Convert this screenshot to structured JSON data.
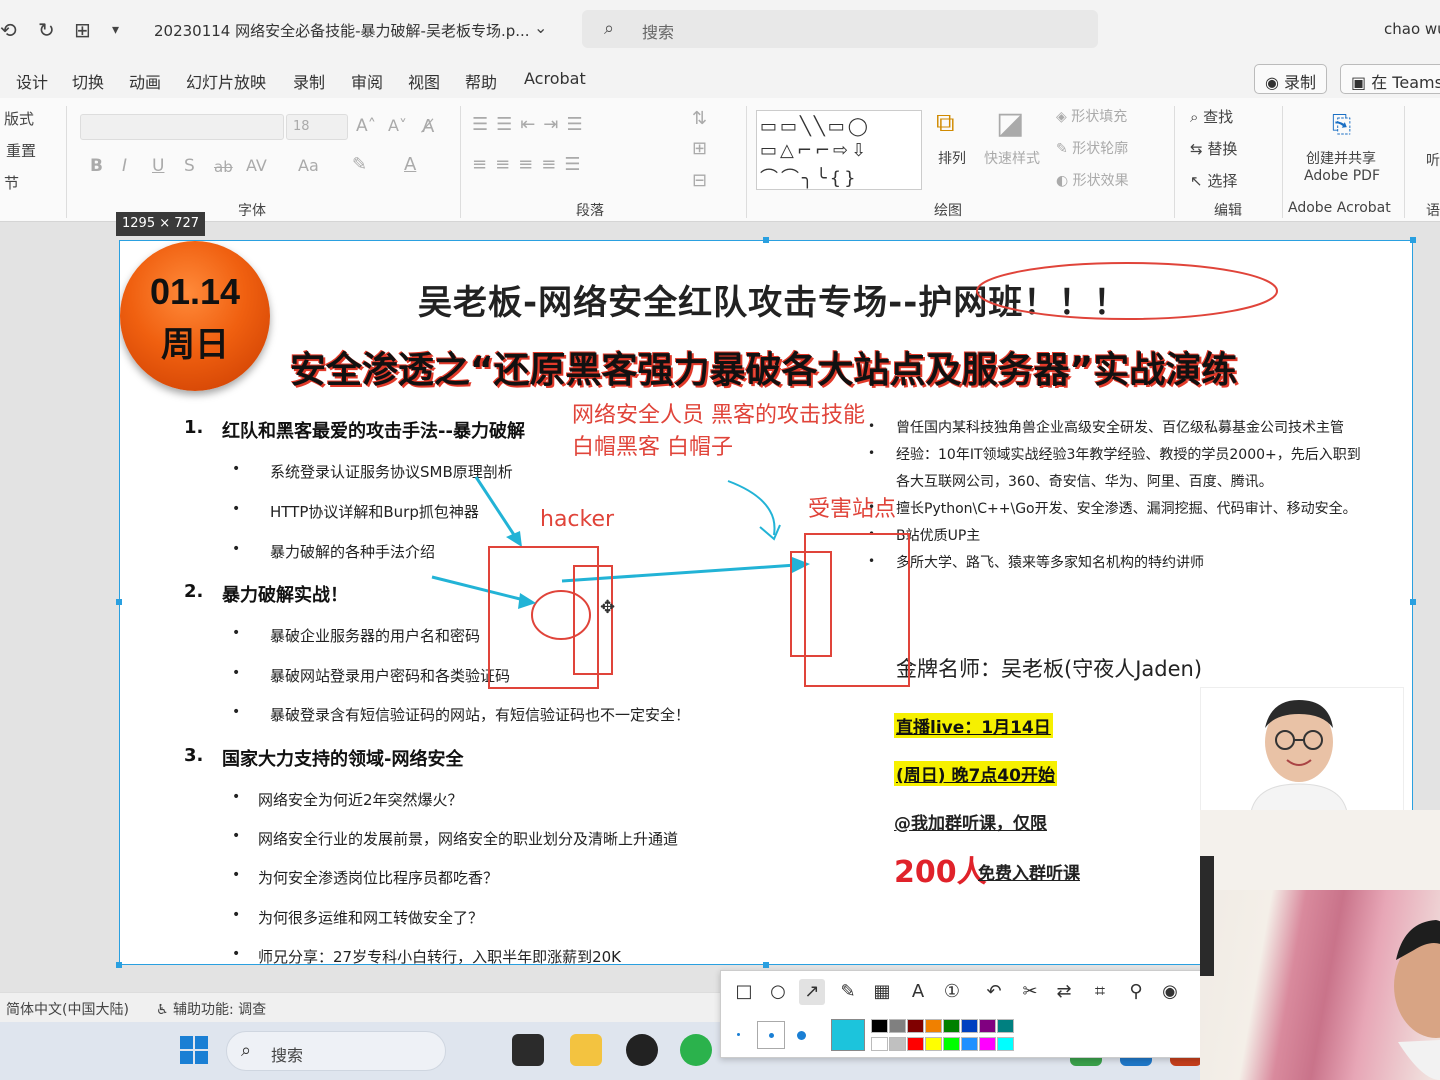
{
  "titlebar": {
    "doc_title": "20230114 网络安全必备技能-暴力破解-吴老板专场.p...",
    "search_placeholder": "搜索",
    "user": "chao wu"
  },
  "menu": {
    "tabs": [
      "设计",
      "切换",
      "动画",
      "幻灯片放映",
      "录制",
      "审阅",
      "视图",
      "帮助",
      "Acrobat"
    ],
    "record_button": "录制",
    "teams_button": "在 Teams"
  },
  "ribbon": {
    "left_items": [
      "版式",
      "重置",
      "节"
    ],
    "font_size": "18",
    "group_font": "字体",
    "group_paragraph": "段落",
    "group_drawing": "绘图",
    "group_editing": "编辑",
    "group_acrobat": "Adobe Acrobat",
    "arrange": "排列",
    "quick_styles": "快速样式",
    "shape_fill": "形状填充",
    "shape_outline": "形状轮廓",
    "shape_effects": "形状效果",
    "find": "查找",
    "replace": "替换",
    "select": "选择",
    "create_pdf_1": "创建并共享",
    "create_pdf_2": "Adobe PDF",
    "listen": "听",
    "lang": "语"
  },
  "dimension_tooltip": "1295 × 727",
  "slide": {
    "badge_date": "01.14",
    "badge_day": "周日",
    "heading1": "吴老板-网络安全红队攻击专场--护网班！！！",
    "heading2": "安全渗透之“还原黑客强力暴破各大站点及服务器”实战演练",
    "sections": [
      {
        "num": "1.",
        "title": "红队和黑客最爱的攻击手法--暴力破解",
        "items": [
          "系统登录认证服务协议SMB原理剖析",
          "HTTP协议详解和Burp抓包神器",
          "暴力破解的各种手法介绍"
        ]
      },
      {
        "num": "2.",
        "title": "暴力破解实战！",
        "items": [
          "暴破企业服务器的用户名和密码",
          "暴破网站登录用户密码和各类验证码",
          "暴破登录含有短信验证码的网站，有短信验证码也不一定安全！"
        ]
      },
      {
        "num": "3.",
        "title": "国家大力支持的领域-网络安全",
        "items": [
          "网络安全为何近2年突然爆火？",
          "网络安全行业的发展前景，网络安全的职业划分及清晰上升通道",
          "为何安全渗透岗位比程序员都吃香？",
          "为何很多运维和网工转做安全了？",
          "师兄分享：27岁专科小白转行，入职半年即涨薪到20K"
        ]
      }
    ],
    "annotations": {
      "line1": "网络安全人员  黑客的攻击技能",
      "line2": "白帽黑客  白帽子",
      "hacker": "hacker",
      "victim": "受害站点"
    },
    "bio": [
      "曾任国内某科技独角兽企业高级安全研发、百亿级私募基金公司技术主管",
      "经验：10年IT领域实战经验3年教学经验、教授的学员2000+，先后入职到",
      "各大互联网公司，360、奇安信、华为、阿里、百度、腾讯。",
      "擅长Python\\C++\\Go开发、安全渗透、漏洞挖掘、代码审计、移动安全。",
      "B站优质UP主",
      "多所大学、路飞、猿来等多家知名机构的特约讲师"
    ],
    "teacher": "金牌名师：吴老板(守夜人Jaden)",
    "live_date": "直播live：1月14日",
    "live_time": "(周日) 晚7点40开始",
    "join": "@我加群听课，仅限",
    "people": "200人",
    "free": "免费入群听课"
  },
  "statusbar": {
    "language": "简体中文(中国大陆)",
    "accessibility": "辅助功能: 调查"
  },
  "taskbar": {
    "search_placeholder": "搜索"
  },
  "colors": {
    "accent": "#2aa0e0",
    "annotation_red": "#e0443a",
    "arrow_cyan": "#22b3d6",
    "highlight": "#f6f000",
    "badge_orange": "#f06010",
    "current_color": "#1cc4dc"
  },
  "annotation_toolbar": {
    "tools": [
      "rectangle-icon",
      "ellipse-icon",
      "arrow-icon",
      "pen-icon",
      "mosaic-icon",
      "text-icon",
      "number-icon",
      "undo-icon",
      "cut-icon",
      "translate-icon",
      "ocr-icon",
      "pin-icon",
      "record-icon"
    ],
    "palette": [
      "#000000",
      "#808080",
      "#800000",
      "#f08000",
      "#008000",
      "#0040c0",
      "#800080",
      "#008080",
      "#ffffff",
      "#c0c0c0",
      "#ff0000",
      "#ffff00",
      "#00ff00",
      "#1e90ff",
      "#ff00ff",
      "#00ffff"
    ]
  }
}
